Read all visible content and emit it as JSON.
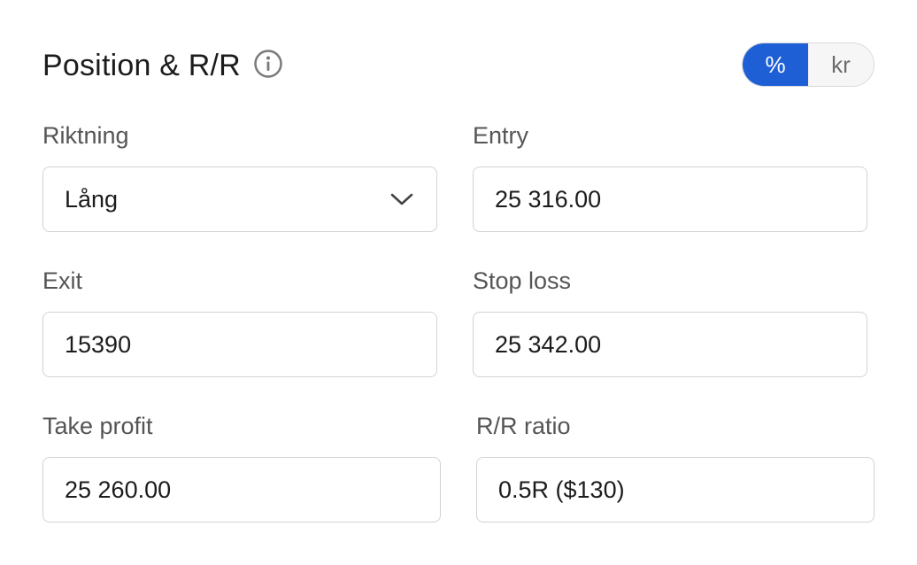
{
  "header": {
    "title": "Position & R/R",
    "info_icon": "info-icon",
    "unit_toggle": {
      "options": [
        "%",
        "kr"
      ],
      "selected": "%",
      "accent_color": "#1f5fd6"
    }
  },
  "fields": {
    "direction": {
      "label": "Riktning",
      "value": "Lång",
      "icon": "chevron-down-icon"
    },
    "entry": {
      "label": "Entry",
      "value": "25 316.00"
    },
    "exit": {
      "label": "Exit",
      "value": "15390"
    },
    "stop_loss": {
      "label": "Stop loss",
      "value": "25 342.00"
    },
    "take_profit": {
      "label": "Take profit",
      "value": "25 260.00"
    },
    "rr_ratio": {
      "label": "R/R ratio",
      "value": "0.5R ($130)"
    }
  }
}
